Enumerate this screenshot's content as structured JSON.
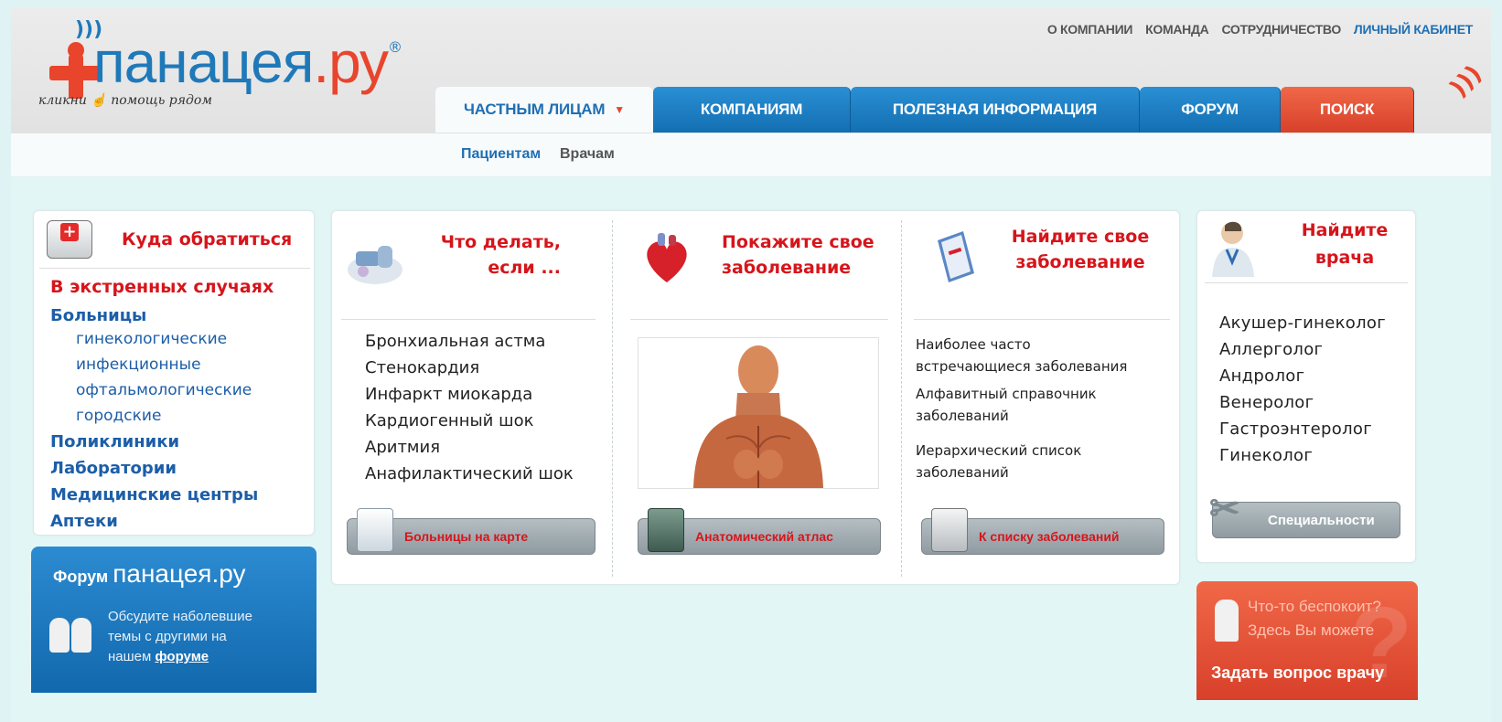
{
  "logo": {
    "word": "панацея",
    "suffix": ".ру",
    "reg": "®",
    "tagline": "кликни ☝ помощь рядом"
  },
  "top_links": [
    "О КОМПАНИИ",
    "КОМАНДА",
    "СОТРУДНИЧЕСТВО",
    "ЛИЧНЫЙ КАБИНЕТ"
  ],
  "tabs": {
    "private": "ЧАСТНЫМ ЛИЦАМ",
    "caret": "▼",
    "companies": "КОМПАНИЯМ",
    "info": "ПОЛЕЗНАЯ ИНФОРМАЦИЯ",
    "forum": "ФОРУМ",
    "search": "ПОИСК"
  },
  "subnav": {
    "patients": "Пациентам",
    "doctors": "Врачам"
  },
  "where": {
    "title": "Куда обратиться",
    "emergency": "В экстренных случаях",
    "hospitals": "Больницы",
    "hospital_types": [
      "гинекологические",
      "инфекционные",
      "офтальмологические",
      "городские"
    ],
    "other": [
      "Поликлиники",
      "Лаборатории",
      "Медицинские центры",
      "Аптеки"
    ]
  },
  "forum_box": {
    "label": "Форум",
    "brand": "панацея.ру",
    "text_1": "Обсудите наболевшие",
    "text_2": "темы с другими на",
    "text_3": "нашем",
    "link": "форуме"
  },
  "what_to_do": {
    "title_1": "Что делать,",
    "title_2": "если ...",
    "items": [
      "Бронхиальная астма",
      "Стенокардия",
      "Инфаркт миокарда",
      "Кардиогенный шок",
      "Аритмия",
      "Анафилактический шок"
    ],
    "button": "Больницы на карте"
  },
  "show_disease": {
    "title_1": "Покажите свое",
    "title_2": "заболевание",
    "button": "Анатомический атлас"
  },
  "find_disease": {
    "title_1": "Найдите свое",
    "title_2": "заболевание",
    "items": [
      [
        "Наиболее часто",
        "встречающиеся заболевания"
      ],
      [
        "Алфавитный справочник",
        "заболеваний"
      ],
      [
        "Иерархический список",
        "заболеваний"
      ]
    ],
    "button": "К списку заболеваний"
  },
  "find_doctor": {
    "title_1": "Найдите",
    "title_2": "врача",
    "items": [
      "Акушер-гинеколог",
      "Аллерголог",
      "Андролог",
      "Венеролог",
      "Гастроэнтеролог",
      "Гинеколог"
    ],
    "button": "Специальности"
  },
  "ask_box": {
    "line_1": "Что-то беспокоит?",
    "line_2": "Здесь Вы можете",
    "button": "Задать вопрос врачу",
    "mark": "?"
  }
}
